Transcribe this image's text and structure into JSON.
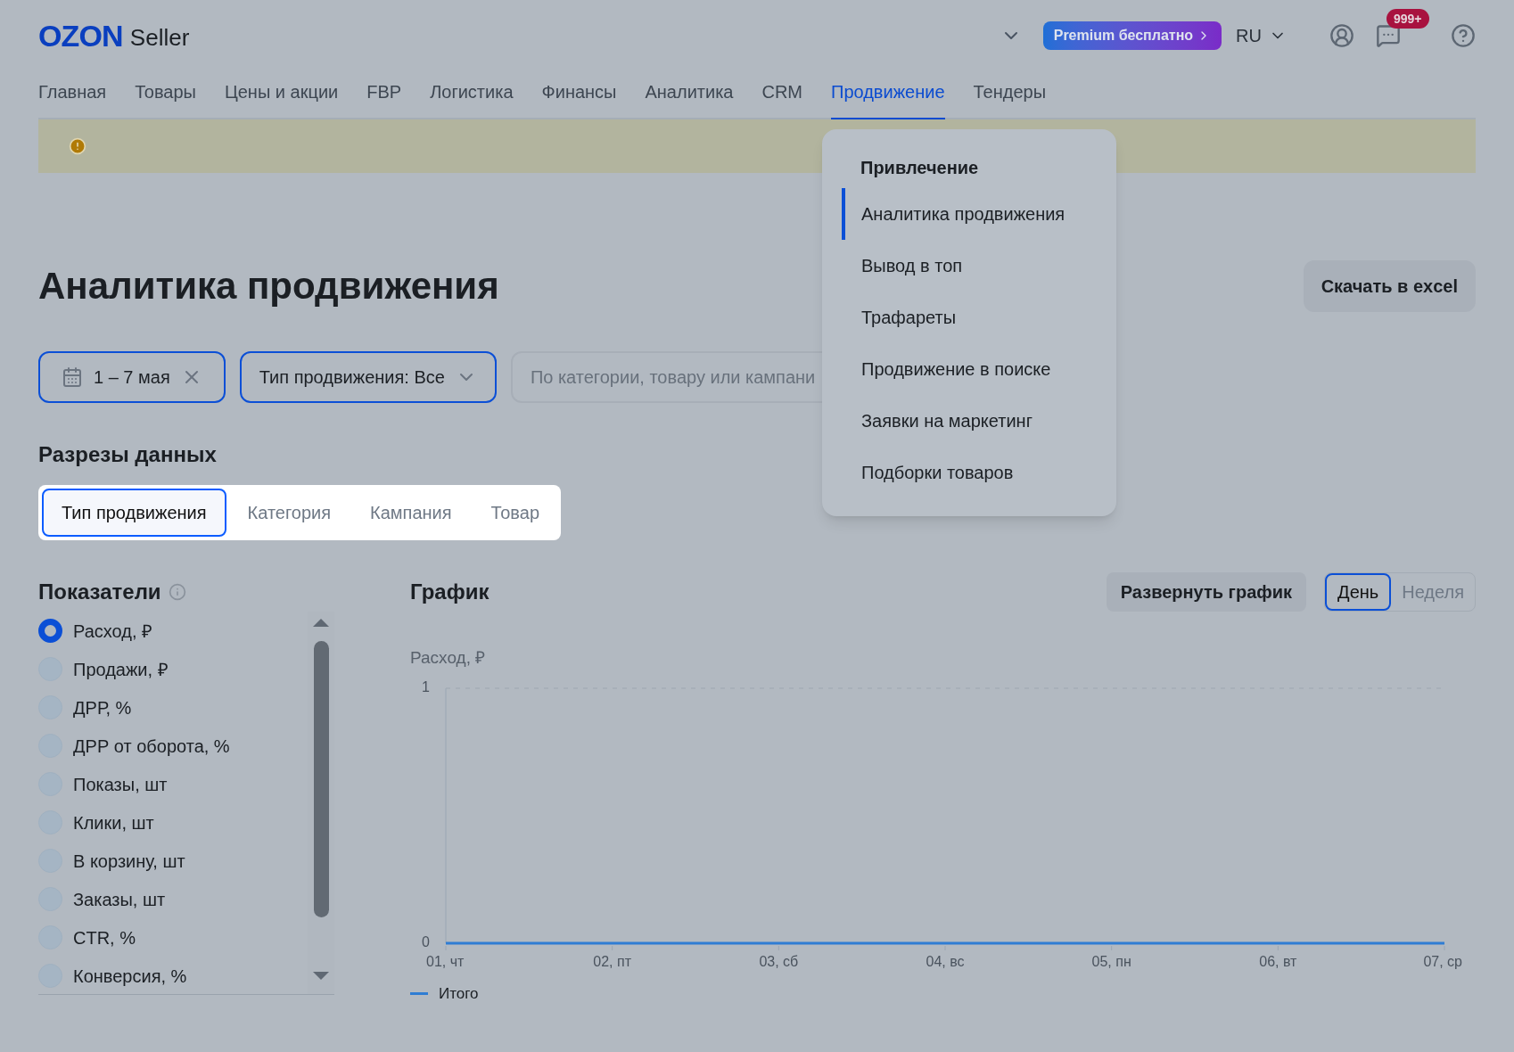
{
  "header": {
    "logo": "OZON",
    "logo_suffix": "Seller",
    "premium_button": "Premium бесплатно",
    "language": "RU",
    "notifications_badge": "999+"
  },
  "nav": [
    {
      "label": "Главная",
      "selected": false
    },
    {
      "label": "Товары",
      "selected": false
    },
    {
      "label": "Цены и акции",
      "selected": false
    },
    {
      "label": "FBP",
      "selected": false
    },
    {
      "label": "Логистика",
      "selected": false
    },
    {
      "label": "Финансы",
      "selected": false
    },
    {
      "label": "Аналитика",
      "selected": false
    },
    {
      "label": "CRM",
      "selected": false
    },
    {
      "label": "Продвижение",
      "selected": true
    },
    {
      "label": "Тендеры",
      "selected": false
    }
  ],
  "menu": {
    "section_title": "Привлечение",
    "items": [
      {
        "label": "Аналитика продвижения",
        "selected": true
      },
      {
        "label": "Вывод в топ",
        "selected": false
      },
      {
        "label": "Трафареты",
        "selected": false
      },
      {
        "label": "Продвижение в поиске",
        "selected": false
      },
      {
        "label": "Заявки на маркетинг",
        "selected": false
      },
      {
        "label": "Подборки товаров",
        "selected": false
      }
    ]
  },
  "page_title": "Аналитика продвижения",
  "download_button": "Скачать в excel",
  "filters": {
    "date": "1 – 7 мая",
    "promotion_type": "Тип продвижения: Все",
    "search": {
      "placeholder": "По категории, товару или кампани"
    }
  },
  "slices": {
    "title": "Разрезы данных",
    "tabs": [
      {
        "label": "Тип продвижения",
        "selected": true
      },
      {
        "label": "Категория",
        "selected": false
      },
      {
        "label": "Кампания",
        "selected": false
      },
      {
        "label": "Товар",
        "selected": false
      }
    ]
  },
  "metrics": {
    "title": "Показатели",
    "items": [
      {
        "label": "Расход, ₽",
        "selected": true
      },
      {
        "label": "Продажи, ₽",
        "selected": false
      },
      {
        "label": "ДРР, %",
        "selected": false
      },
      {
        "label": "ДРР от оборота, %",
        "selected": false
      },
      {
        "label": "Показы, шт",
        "selected": false
      },
      {
        "label": "Клики, шт",
        "selected": false
      },
      {
        "label": "В корзину, шт",
        "selected": false
      },
      {
        "label": "Заказы, шт",
        "selected": false
      },
      {
        "label": "CTR, %",
        "selected": false
      },
      {
        "label": "Конверсия, %",
        "selected": false
      }
    ]
  },
  "chart": {
    "title": "График",
    "expand_button": "Развернуть график",
    "periods": [
      {
        "label": "День",
        "selected": true
      },
      {
        "label": "Неделя",
        "selected": false
      }
    ],
    "chart_data": {
      "type": "line",
      "ylabel": "Расход, ₽",
      "categories": [
        "01, чт",
        "02, пт",
        "03, сб",
        "04, вс",
        "05, пн",
        "06, вт",
        "07, ср"
      ],
      "ylim": [
        0,
        1
      ],
      "yticks": [
        0,
        1
      ],
      "series": [
        {
          "name": "Итого",
          "color": "#2f7dd3",
          "values": [
            0,
            0,
            0,
            0,
            0,
            0,
            0
          ]
        }
      ]
    }
  }
}
